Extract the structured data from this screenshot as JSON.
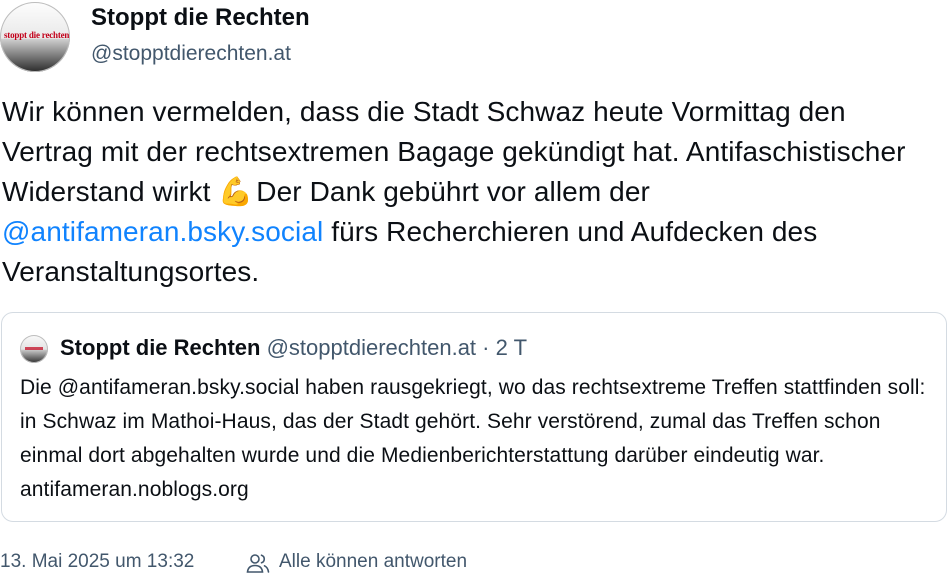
{
  "author": {
    "display_name": "Stoppt die Rechten",
    "handle": "@stopptdierechten.at",
    "avatar_logo_text": "stoppt die rechten"
  },
  "post": {
    "text_before_mention_1": "Wir können vermelden, dass die Stadt Schwaz heute Vormittag den Vertrag mit der rechtsextremen Bagage gekündigt hat. Antifaschistischer Widerstand wirkt ",
    "emoji": "💪",
    "text_after_emoji": " Der Dank gebührt vor allem der ",
    "mention": "@antifameran.bsky.social",
    "text_after_mention": " fürs Recherchieren und Aufdecken des Veranstaltungsortes."
  },
  "quote": {
    "display_name": "Stoppt die Rechten",
    "handle": "@stopptdierechten.at",
    "separator": "·",
    "relative_time": "2 T",
    "text": "Die @antifameran.bsky.social haben rausgekriegt, wo das rechtsextreme Treffen stattfinden soll: in Schwaz im Mathoi-Haus, das der Stadt gehört. Sehr verstörend, zumal das Treffen schon einmal dort abgehalten wurde und die Medienberichterstattung darüber eindeutig war. antifameran.noblogs.org"
  },
  "footer": {
    "timestamp": "13. Mai 2025 um 13:32",
    "reply_icon": "people-icon",
    "reply_setting": "Alle können antworten"
  },
  "colors": {
    "text": "#0b0f14",
    "muted": "#42576c",
    "link": "#1083fe",
    "border": "#d4dbe2"
  }
}
